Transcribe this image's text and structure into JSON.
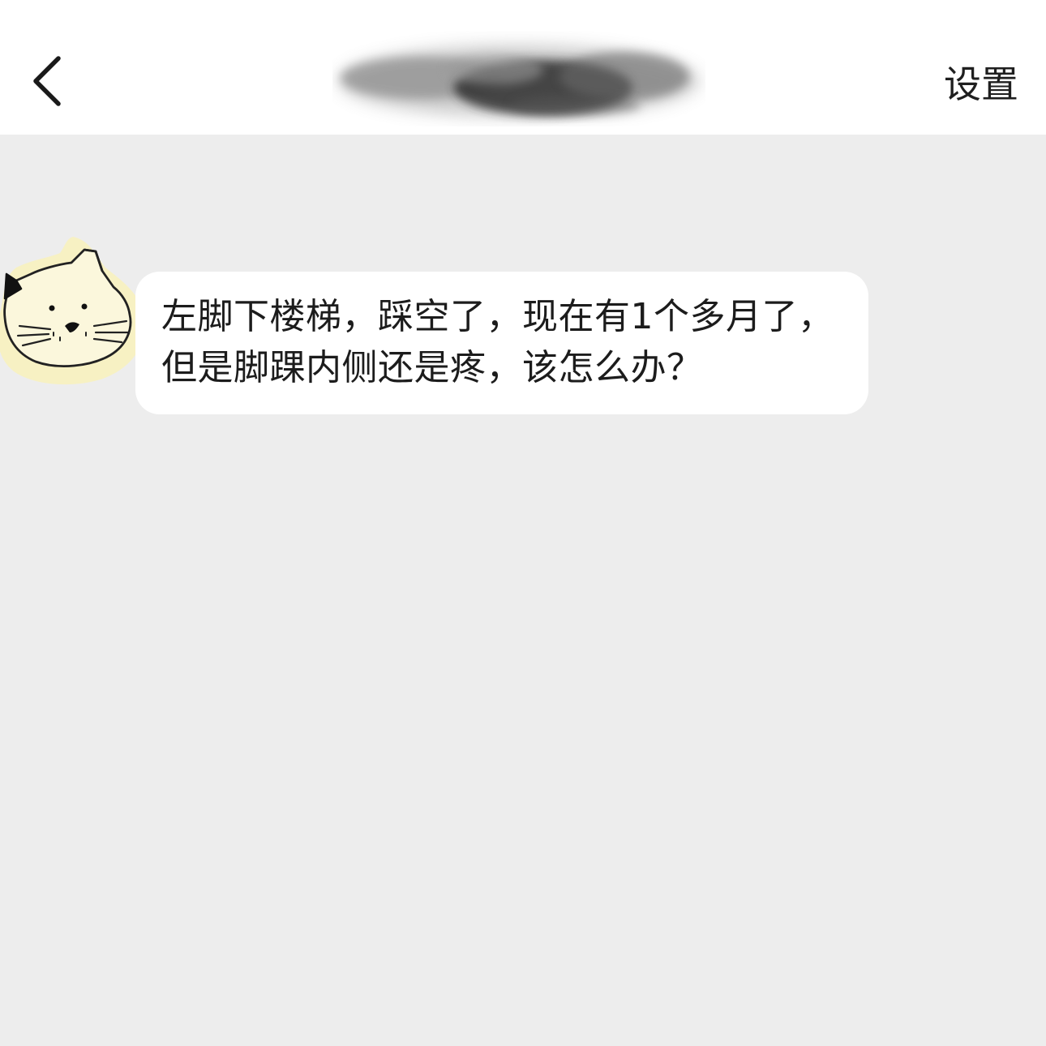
{
  "nav": {
    "back_icon": "chevron-left-icon",
    "title": "",
    "settings_label": "设置"
  },
  "colors": {
    "nav_background": "#ffffff",
    "chat_background": "#ededed",
    "bubble_background": "#ffffff",
    "text": "#1c1c1c",
    "avatar_background": "#f7f1c3"
  },
  "messages": [
    {
      "sender": "other",
      "avatar_icon": "cat-avatar-icon",
      "text": "左脚下楼梯，踩空了，现在有1个多月了，但是脚踝内侧还是疼，该怎么办？"
    }
  ]
}
